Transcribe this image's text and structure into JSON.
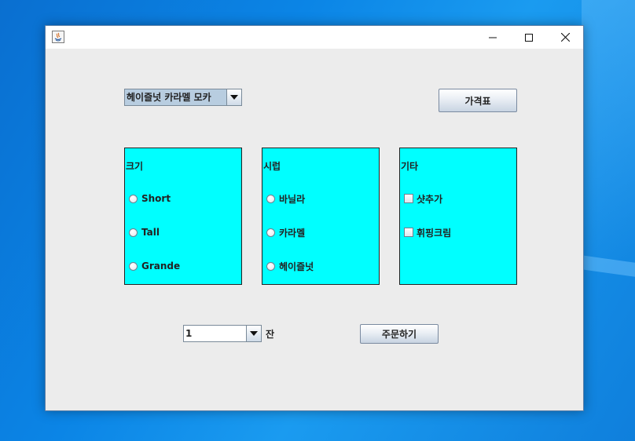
{
  "window": {
    "icon": "java-icon",
    "controls": {
      "minimize": "minimize-icon",
      "maximize": "maximize-icon",
      "close": "close-icon"
    }
  },
  "drink_select": {
    "value": "헤이즐넛 카라멜 모카"
  },
  "price_button": {
    "label": "가격표"
  },
  "size_panel": {
    "title": "크기",
    "options": [
      "Short",
      "Tall",
      "Grande"
    ]
  },
  "syrup_panel": {
    "title": "시럽",
    "options": [
      "바닐라",
      "카라멜",
      "헤이즐넛"
    ]
  },
  "etc_panel": {
    "title": "기타",
    "options": [
      "샷추가",
      "휘핑크림"
    ]
  },
  "quantity": {
    "value": "1",
    "unit": "잔"
  },
  "order_button": {
    "label": "주문하기"
  },
  "colors": {
    "panel_bg": "#00ffff",
    "window_bg": "#ececec"
  }
}
